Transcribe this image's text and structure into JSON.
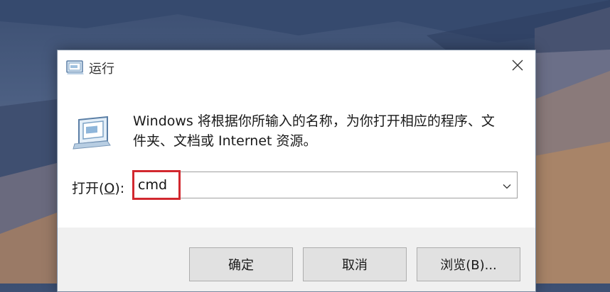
{
  "dialog": {
    "title": "运行",
    "close_icon": "close-icon",
    "run_icon": "run-window-icon",
    "description_line1": "Windows 将根据你所输入的名称，为你打开相应的程序、文",
    "description_line2": "件夹、文档或 Internet 资源。",
    "open_label_prefix": "打开(",
    "open_label_accel": "O",
    "open_label_suffix": "):",
    "input_value": "cmd",
    "dropdown_icon": "chevron-down-icon",
    "highlight_color": "#d2282f",
    "buttons": {
      "ok": "确定",
      "cancel": "取消",
      "browse": "浏览(B)..."
    }
  }
}
